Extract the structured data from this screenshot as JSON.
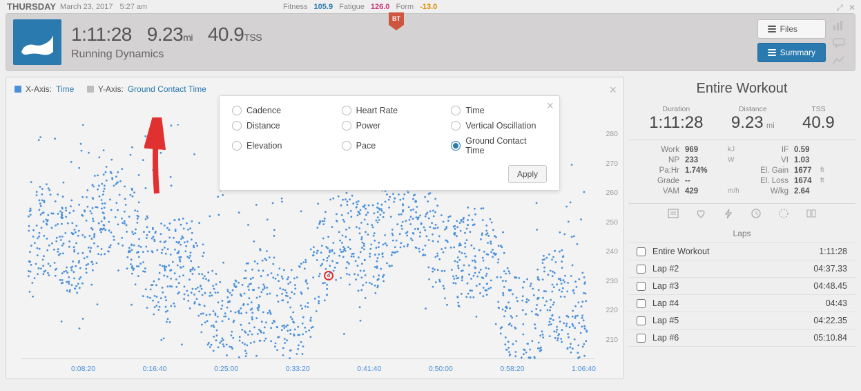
{
  "header": {
    "day": "THURSDAY",
    "date": "March 23, 2017",
    "time": "5:27 am",
    "fitness_label": "Fitness",
    "fitness": "105.9",
    "fatigue_label": "Fatigue",
    "fatigue": "126.0",
    "form_label": "Form",
    "form": "-13.0",
    "bt": "BT"
  },
  "stats": {
    "duration": "1:11:28",
    "distance": "9.23",
    "distance_unit": "mi",
    "tss": "40.9",
    "tss_unit": "TSS",
    "title": "Running Dynamics"
  },
  "buttons": {
    "files": "Files",
    "summary": "Summary"
  },
  "axis": {
    "x_label": "X-Axis:",
    "x_value": "Time",
    "y_label": "Y-Axis:",
    "y_value": "Ground Contact Time"
  },
  "popover": {
    "options": [
      "Cadence",
      "Heart Rate",
      "Time",
      "Distance",
      "Power",
      "Vertical Oscillation",
      "Elevation",
      "Pace",
      "Ground Contact Time"
    ],
    "selected": "Ground Contact Time",
    "apply": "Apply"
  },
  "side": {
    "title": "Entire Workout",
    "summary": [
      {
        "label": "Duration",
        "value": "1:11:28",
        "unit": ""
      },
      {
        "label": "Distance",
        "value": "9.23",
        "unit": "mi"
      },
      {
        "label": "TSS",
        "value": "40.9",
        "unit": ""
      }
    ],
    "kv": [
      {
        "k1": "Work",
        "v1": "969",
        "u1": "kJ",
        "k2": "IF",
        "v2": "0.59",
        "u2": ""
      },
      {
        "k1": "NP",
        "v1": "233",
        "u1": "W",
        "k2": "VI",
        "v2": "1.03",
        "u2": ""
      },
      {
        "k1": "Pa:Hr",
        "v1": "1.74%",
        "u1": "",
        "k2": "El. Gain",
        "v2": "1677",
        "u2": "ft"
      },
      {
        "k1": "Grade",
        "v1": "--",
        "u1": "",
        "k2": "El. Loss",
        "v2": "1674",
        "u2": "ft"
      },
      {
        "k1": "VAM",
        "v1": "429",
        "u1": "m/h",
        "k2": "W/kg",
        "v2": "2.64",
        "u2": ""
      }
    ],
    "laps_title": "Laps",
    "laps": [
      {
        "name": "Entire Workout",
        "time": "1:11:28"
      },
      {
        "name": "Lap #2",
        "time": "04:37.33"
      },
      {
        "name": "Lap #3",
        "time": "04:48.45"
      },
      {
        "name": "Lap #4",
        "time": "04:43"
      },
      {
        "name": "Lap #5",
        "time": "04:22.35"
      },
      {
        "name": "Lap #6",
        "time": "05:10.84"
      }
    ]
  },
  "chart_data": {
    "type": "scatter",
    "xlabel": "Time",
    "ylabel": "Ground Contact Time (ms)",
    "ylim": [
      210,
      280
    ],
    "y_ticks": [
      280,
      270,
      260,
      250,
      240,
      230,
      220,
      210
    ],
    "x_ticks": [
      "0:08:20",
      "0:16:40",
      "0:25:00",
      "0:33:20",
      "0:41:40",
      "0:50:00",
      "0:58:20",
      "1:06:40"
    ],
    "marker_at": {
      "x_tick": "0:41:40",
      "y": 240
    },
    "note": "Dense scatter of ground-contact-time samples; band centered ~230–245 ms with excursions 215–275 ms across the run."
  }
}
